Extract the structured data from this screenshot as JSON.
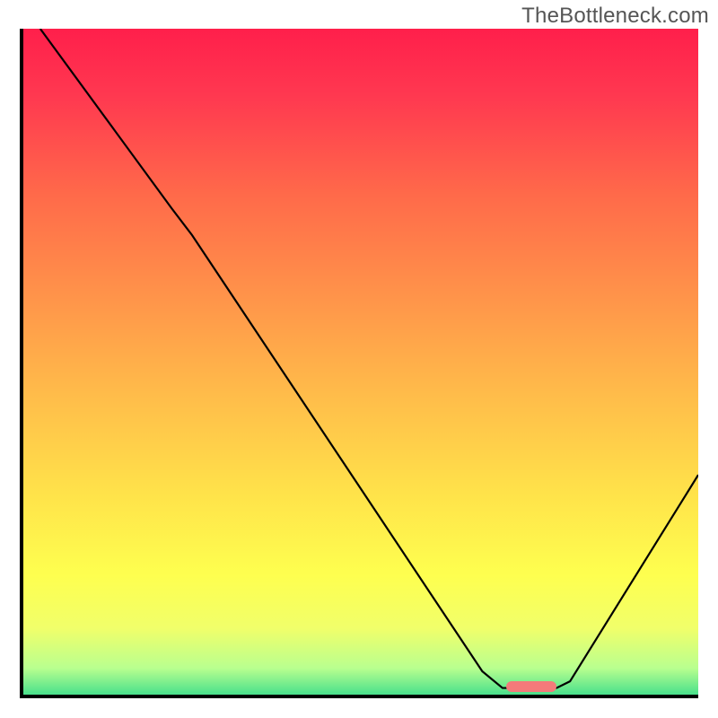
{
  "watermark": {
    "text": "TheBottleneck.com"
  },
  "plot": {
    "inner_w": 752,
    "inner_h": 742,
    "gradient_stops": [
      {
        "offset": 0.0,
        "color": "#ff1f4b"
      },
      {
        "offset": 0.1,
        "color": "#ff3850"
      },
      {
        "offset": 0.25,
        "color": "#ff6a4a"
      },
      {
        "offset": 0.4,
        "color": "#ff934a"
      },
      {
        "offset": 0.55,
        "color": "#ffbc4a"
      },
      {
        "offset": 0.7,
        "color": "#ffe34a"
      },
      {
        "offset": 0.82,
        "color": "#feff4f"
      },
      {
        "offset": 0.9,
        "color": "#f1ff6a"
      },
      {
        "offset": 0.96,
        "color": "#b9ff8f"
      },
      {
        "offset": 1.0,
        "color": "#49e08c"
      }
    ]
  },
  "chart_data": {
    "type": "line",
    "title": "",
    "xlabel": "",
    "ylabel": "",
    "xlim": [
      0,
      100
    ],
    "ylim": [
      0,
      100
    ],
    "legend": false,
    "grid": false,
    "series": [
      {
        "name": "bottleneck-curve",
        "points": [
          {
            "x": 2.5,
            "y": 100.0
          },
          {
            "x": 22.0,
            "y": 73.0
          },
          {
            "x": 25.0,
            "y": 69.0
          },
          {
            "x": 68.0,
            "y": 3.5
          },
          {
            "x": 71.0,
            "y": 1.0
          },
          {
            "x": 79.0,
            "y": 1.0
          },
          {
            "x": 81.0,
            "y": 2.0
          },
          {
            "x": 100.0,
            "y": 33.0
          }
        ]
      }
    ],
    "annotations": [
      {
        "name": "optimal-marker",
        "shape": "rounded-rect",
        "color": "#f47a7a",
        "x0": 71.5,
        "x1": 79.0,
        "y0": 0.4,
        "y1": 2.0
      }
    ]
  }
}
